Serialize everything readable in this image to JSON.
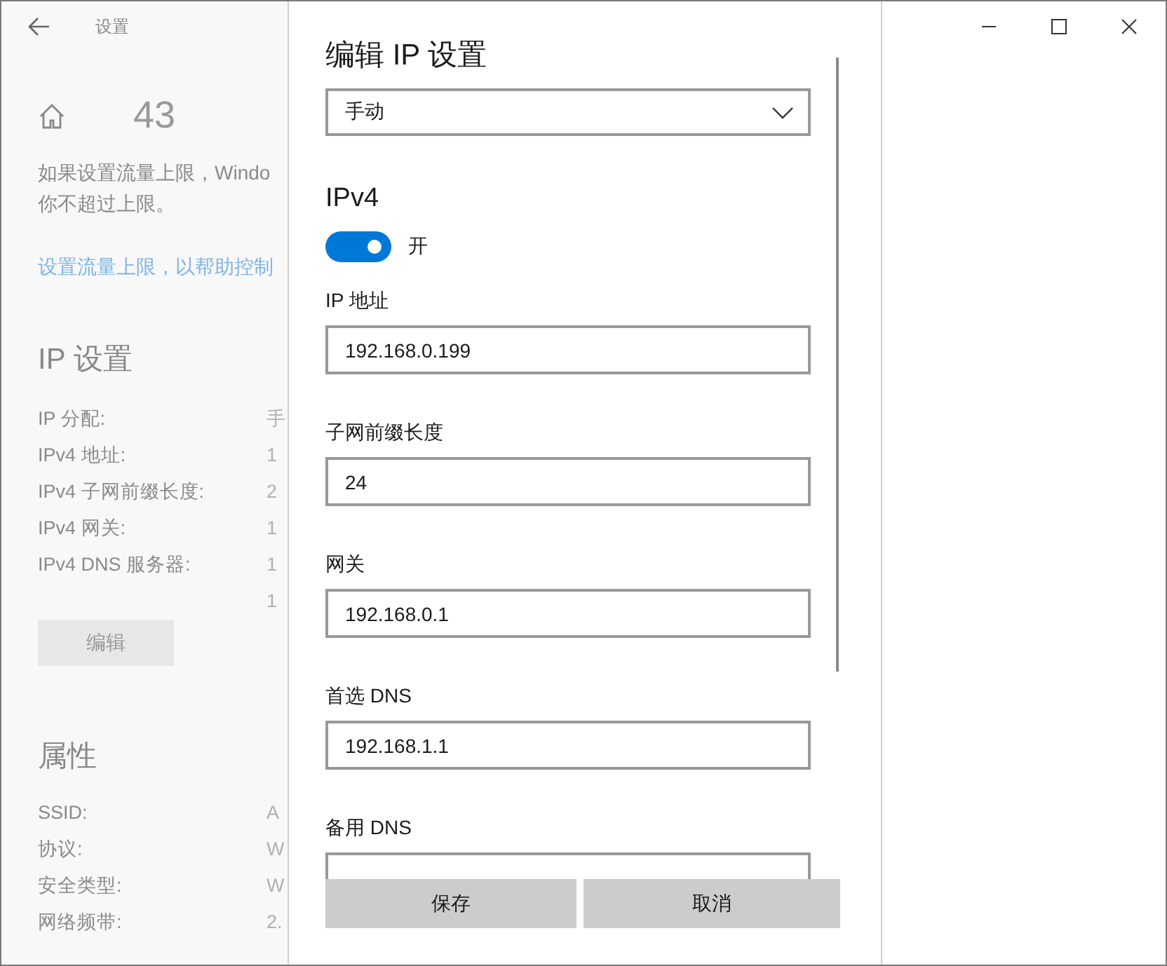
{
  "window": {
    "title": "设置"
  },
  "page": {
    "heading": "43",
    "description": [
      "如果设置流量上限，Windo",
      "你不超过上限。"
    ],
    "link": "设置流量上限，以帮助控制",
    "ip_settings": {
      "heading": "IP 设置",
      "rows": [
        {
          "label": "IP 分配:",
          "values": [
            "手"
          ]
        },
        {
          "label": "IPv4 地址:",
          "values": [
            "1"
          ]
        },
        {
          "label": "IPv4 子网前缀长度:",
          "values": [
            "2"
          ]
        },
        {
          "label": "IPv4 网关:",
          "values": [
            "1"
          ]
        },
        {
          "label": "IPv4 DNS 服务器:",
          "values": [
            "1",
            "1"
          ]
        }
      ],
      "edit_button": "编辑"
    },
    "properties": {
      "heading": "属性",
      "rows": [
        {
          "label": "SSID:",
          "values": [
            "A"
          ]
        },
        {
          "label": "协议:",
          "values": [
            "W"
          ]
        },
        {
          "label": "安全类型:",
          "values": [
            "W"
          ]
        },
        {
          "label": "网络频带:",
          "values": [
            "2."
          ]
        }
      ]
    }
  },
  "dialog": {
    "title": "编辑 IP 设置",
    "mode": "手动",
    "section": "IPv4",
    "toggle": {
      "on": true,
      "label": "开"
    },
    "fields": [
      {
        "label": "IP 地址",
        "value": "192.168.0.199"
      },
      {
        "label": "子网前缀长度",
        "value": "24"
      },
      {
        "label": "网关",
        "value": "192.168.0.1"
      },
      {
        "label": "首选 DNS",
        "value": "192.168.1.1"
      },
      {
        "label": "备用 DNS"
      }
    ],
    "buttons": [
      "保存",
      "取消"
    ]
  }
}
